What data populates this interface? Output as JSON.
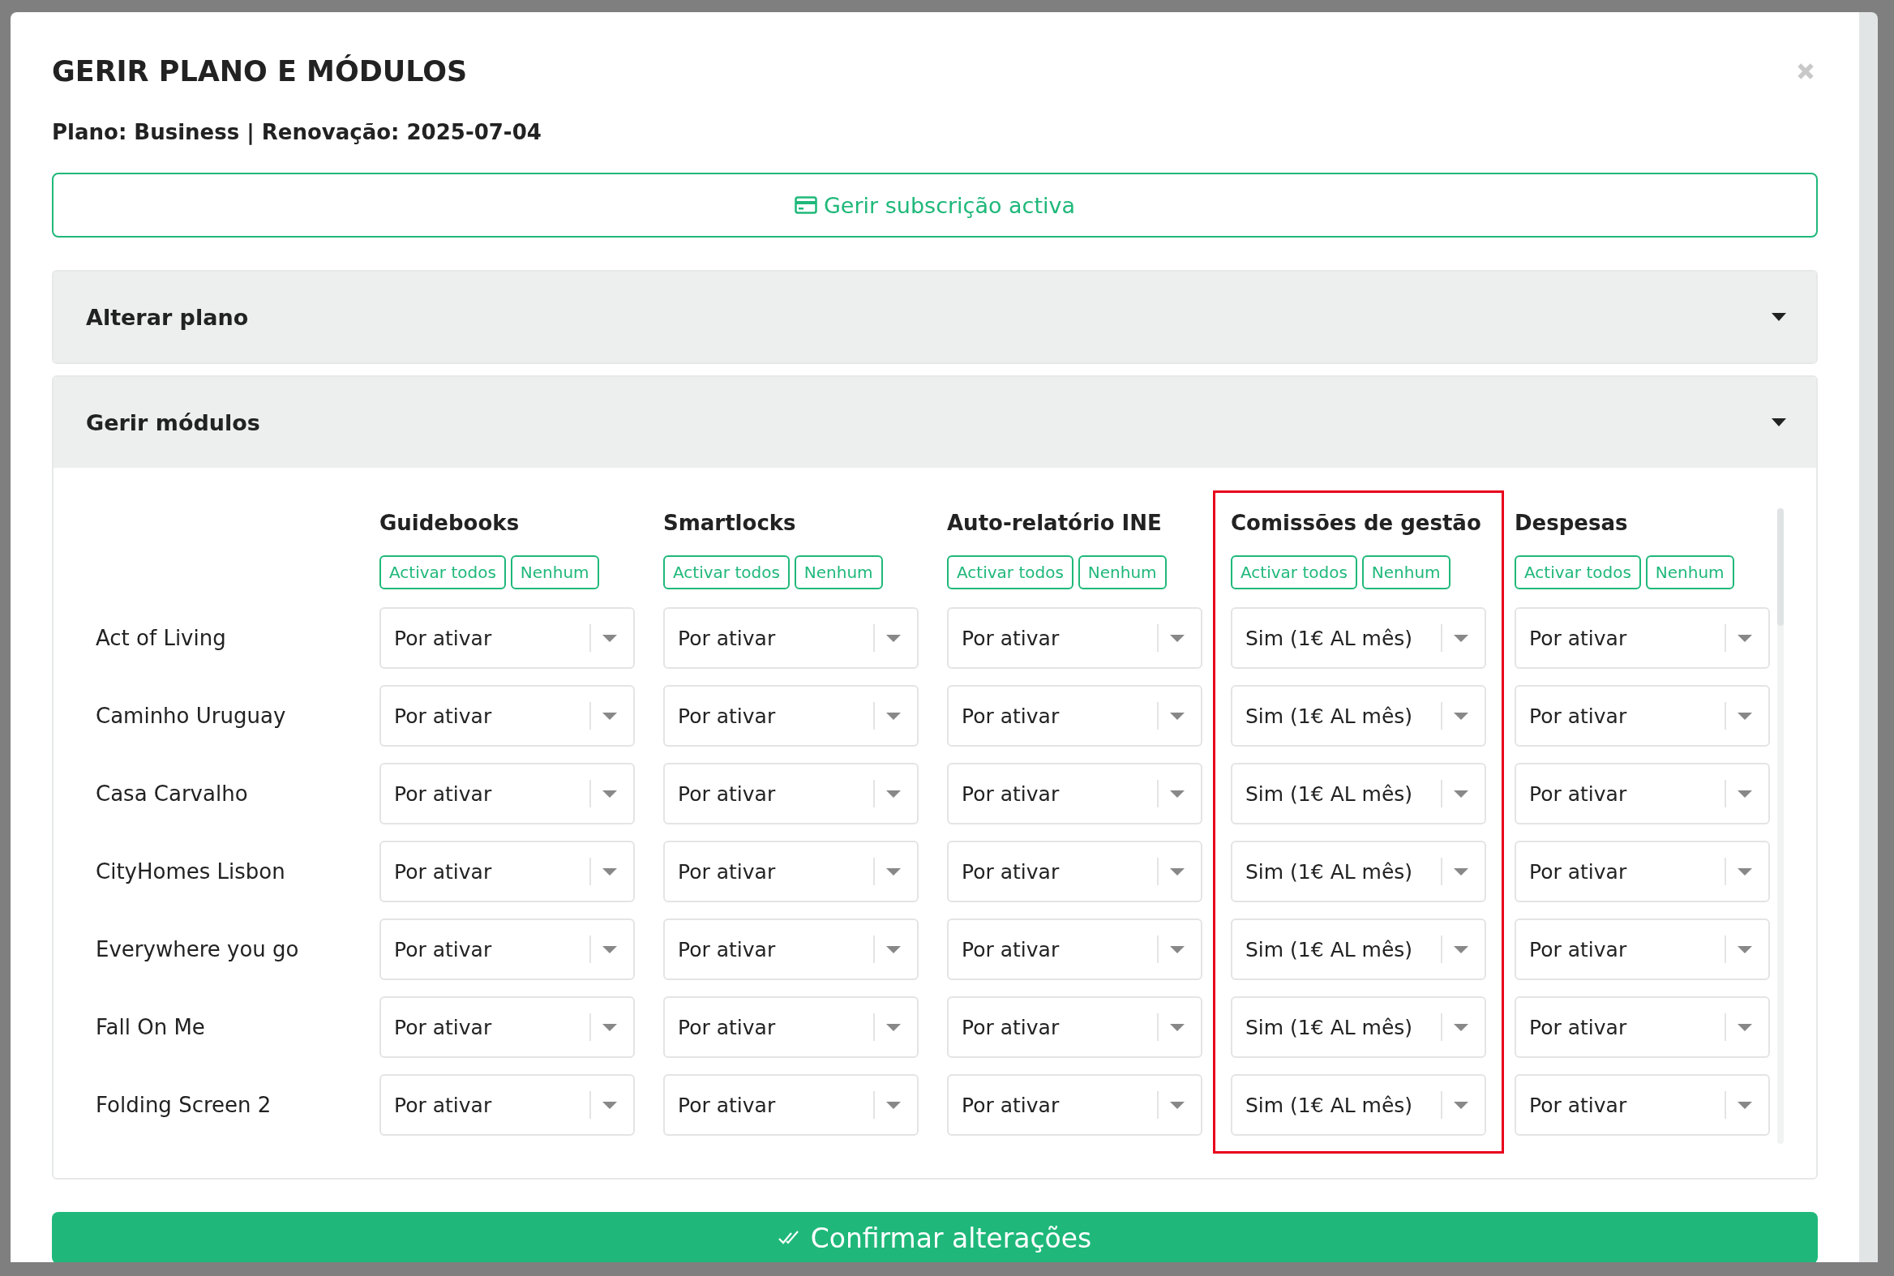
{
  "dialog": {
    "title": "GERIR PLANO E MÓDULOS",
    "subtitle": "Plano: Business | Renovação: 2025-07-04",
    "subscription_button": "Gerir subscrição activa"
  },
  "sections": [
    {
      "title": "Alterar plano",
      "expanded": false
    },
    {
      "title": "Gerir módulos",
      "expanded": true
    }
  ],
  "modules": {
    "columns": [
      {
        "name": "Guidebooks",
        "highlighted": false,
        "buttons": [
          "Activar todos",
          "Nenhum"
        ]
      },
      {
        "name": "Smartlocks",
        "highlighted": false,
        "buttons": [
          "Activar todos",
          "Nenhum"
        ]
      },
      {
        "name": "Auto-relatório INE",
        "highlighted": false,
        "buttons": [
          "Activar todos",
          "Nenhum"
        ]
      },
      {
        "name": "Comissões de gestão",
        "highlighted": true,
        "buttons": [
          "Activar todos",
          "Nenhum"
        ]
      },
      {
        "name": "Despesas",
        "highlighted": false,
        "buttons": [
          "Activar todos",
          "Nenhum"
        ]
      }
    ],
    "rows": [
      {
        "name": "Act of Living",
        "values": [
          "Por ativar",
          "Por ativar",
          "Por ativar",
          "Sim (1€ AL mês)",
          "Por ativar"
        ]
      },
      {
        "name": "Caminho Uruguay",
        "values": [
          "Por ativar",
          "Por ativar",
          "Por ativar",
          "Sim (1€ AL mês)",
          "Por ativar"
        ]
      },
      {
        "name": "Casa Carvalho",
        "values": [
          "Por ativar",
          "Por ativar",
          "Por ativar",
          "Sim (1€ AL mês)",
          "Por ativar"
        ]
      },
      {
        "name": "CityHomes Lisbon",
        "values": [
          "Por ativar",
          "Por ativar",
          "Por ativar",
          "Sim (1€ AL mês)",
          "Por ativar"
        ]
      },
      {
        "name": "Everywhere you go",
        "values": [
          "Por ativar",
          "Por ativar",
          "Por ativar",
          "Sim (1€ AL mês)",
          "Por ativar"
        ]
      },
      {
        "name": "Fall On Me",
        "values": [
          "Por ativar",
          "Por ativar",
          "Por ativar",
          "Sim (1€ AL mês)",
          "Por ativar"
        ]
      },
      {
        "name": "Folding Screen 2",
        "values": [
          "Por ativar",
          "Por ativar",
          "Por ativar",
          "Sim (1€ AL mês)",
          "Por ativar"
        ]
      }
    ]
  },
  "confirm_button": "Confirmar alterações"
}
